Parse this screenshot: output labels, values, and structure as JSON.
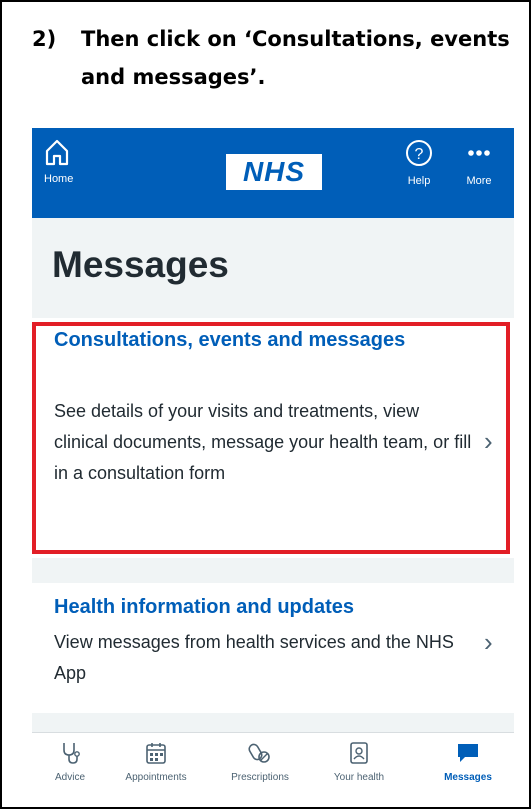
{
  "instruction": {
    "number": "2)",
    "text": "Then click on ‘Consultations, events and messages’."
  },
  "header": {
    "home_label": "Home",
    "logo_text": "NHS",
    "help_label": "Help",
    "more_label": "More",
    "background_color": "#005eb8"
  },
  "page": {
    "title": "Messages"
  },
  "cards": [
    {
      "title": "Consultations, events and messages",
      "description": "See details of your visits and treatments, view clinical documents, message your health team, or fill in a consultation form",
      "highlighted": true
    },
    {
      "title": "Health information and updates",
      "description": "View messages from health services and the NHS App",
      "highlighted": false
    }
  ],
  "highlight_color": "#e21e26",
  "tabbar": {
    "items": [
      {
        "label": "Advice",
        "icon": "stethoscope-icon"
      },
      {
        "label": "Appointments",
        "icon": "calendar-icon"
      },
      {
        "label": "Prescriptions",
        "icon": "pills-icon"
      },
      {
        "label": "Your health",
        "icon": "health-record-icon"
      },
      {
        "label": "Messages",
        "icon": "chat-bubble-icon",
        "active": true
      }
    ]
  }
}
